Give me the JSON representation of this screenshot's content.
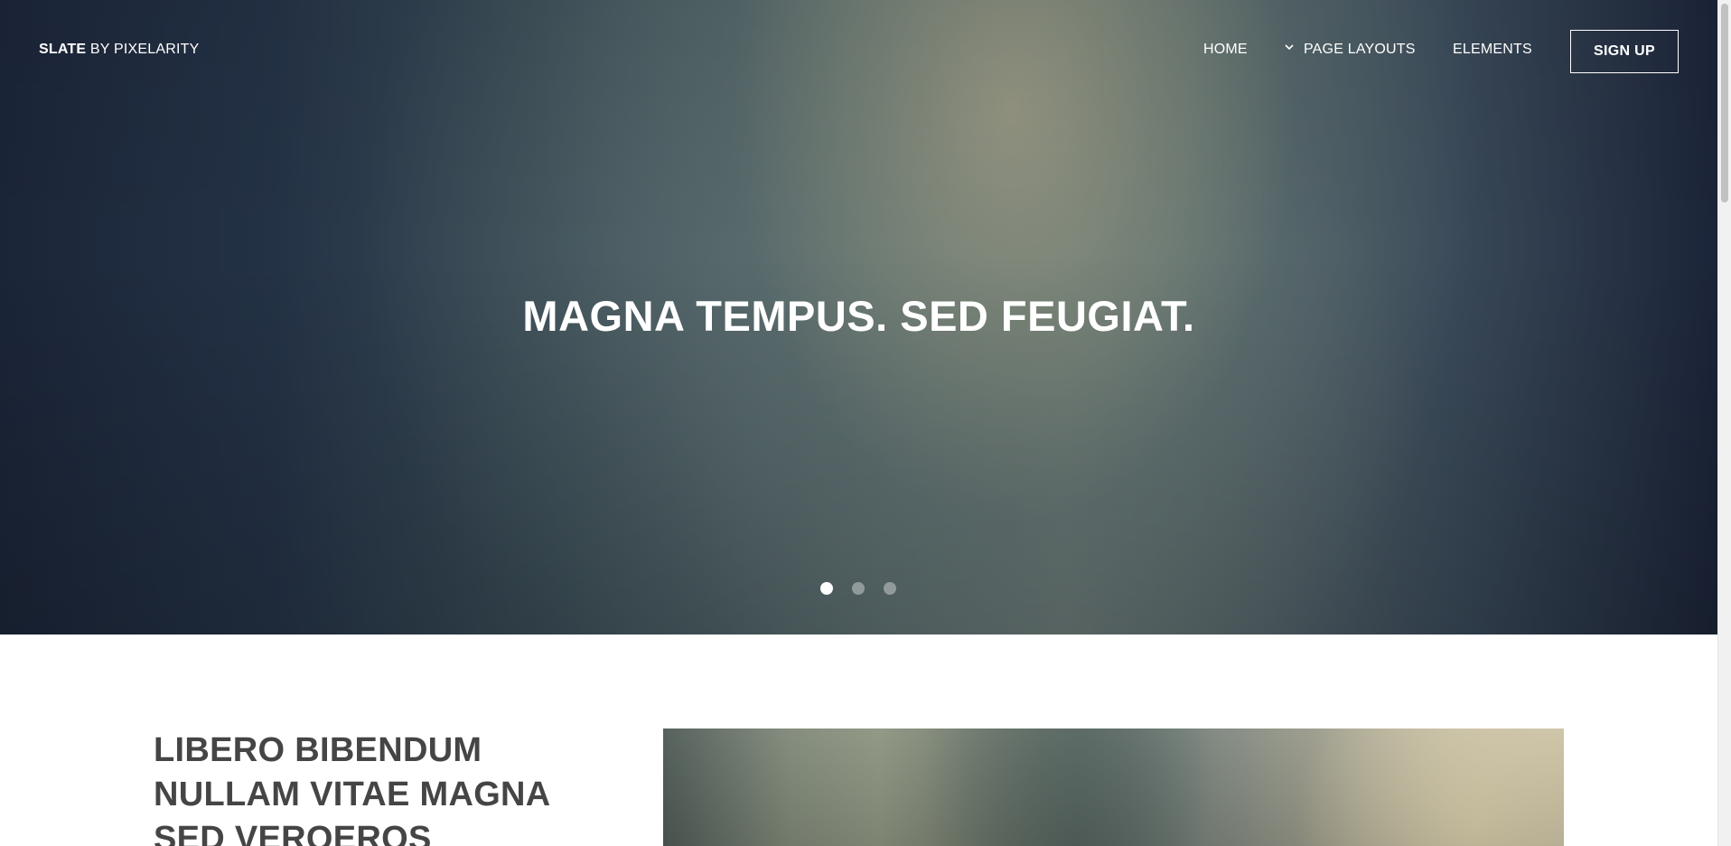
{
  "logo": {
    "brand": "SLATE",
    "suffix": " BY PIXELARITY"
  },
  "nav": {
    "home": "HOME",
    "page_layouts": "PAGE LAYOUTS",
    "elements": "ELEMENTS",
    "signup": "SIGN UP"
  },
  "hero": {
    "title": "MAGNA TEMPUS. SED FEUGIAT.",
    "slides": {
      "count": 3,
      "active": 1
    }
  },
  "section": {
    "title": "LIBERO BIBENDUM NULLAM VITAE MAGNA SED VEROEROS"
  },
  "colors": {
    "text_white": "#ffffff",
    "heading_dark": "#454545"
  },
  "icons": {
    "dropdown": "chevron-down-icon"
  }
}
